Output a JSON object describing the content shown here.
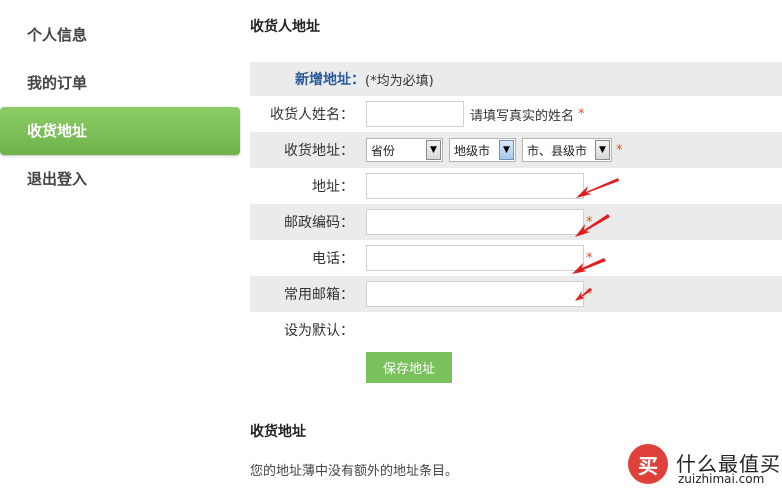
{
  "sidebar": {
    "items": [
      {
        "label": "个人信息"
      },
      {
        "label": "我的订单"
      },
      {
        "label": "收货地址"
      },
      {
        "label": "退出登入"
      }
    ],
    "active_index": 2
  },
  "main": {
    "title": "收货人地址",
    "form": {
      "heading_label": "新增地址：",
      "heading_note": "(*均为必填)",
      "name_label": "收货人姓名：",
      "name_value": "",
      "name_hint": "请填写真实的姓名",
      "required_mark": "*",
      "address_region_label": "收货地址：",
      "province_select": "省份",
      "city_select": "地级市",
      "county_select": "市、县级市",
      "address_label": "地址：",
      "address_value": "",
      "postcode_label": "邮政编码：",
      "postcode_value": "",
      "phone_label": "电话：",
      "phone_value": "",
      "email_label": "常用邮箱：",
      "email_value": "",
      "default_label": "设为默认：",
      "save_button": "保存地址"
    },
    "list_title": "收货地址",
    "empty_message": "您的地址薄中没有额外的地址条目。"
  },
  "watermark": {
    "logo_char": "买",
    "text": "什么最值买",
    "url": "zuizhimai.com"
  },
  "colors": {
    "sidebar_active": "#7ab955",
    "heading_blue": "#2a5a9a",
    "required_red": "#e64a19",
    "row_shade": "#ebebeb",
    "button_green": "#7ac15d",
    "arrow_red": "#e02020"
  }
}
